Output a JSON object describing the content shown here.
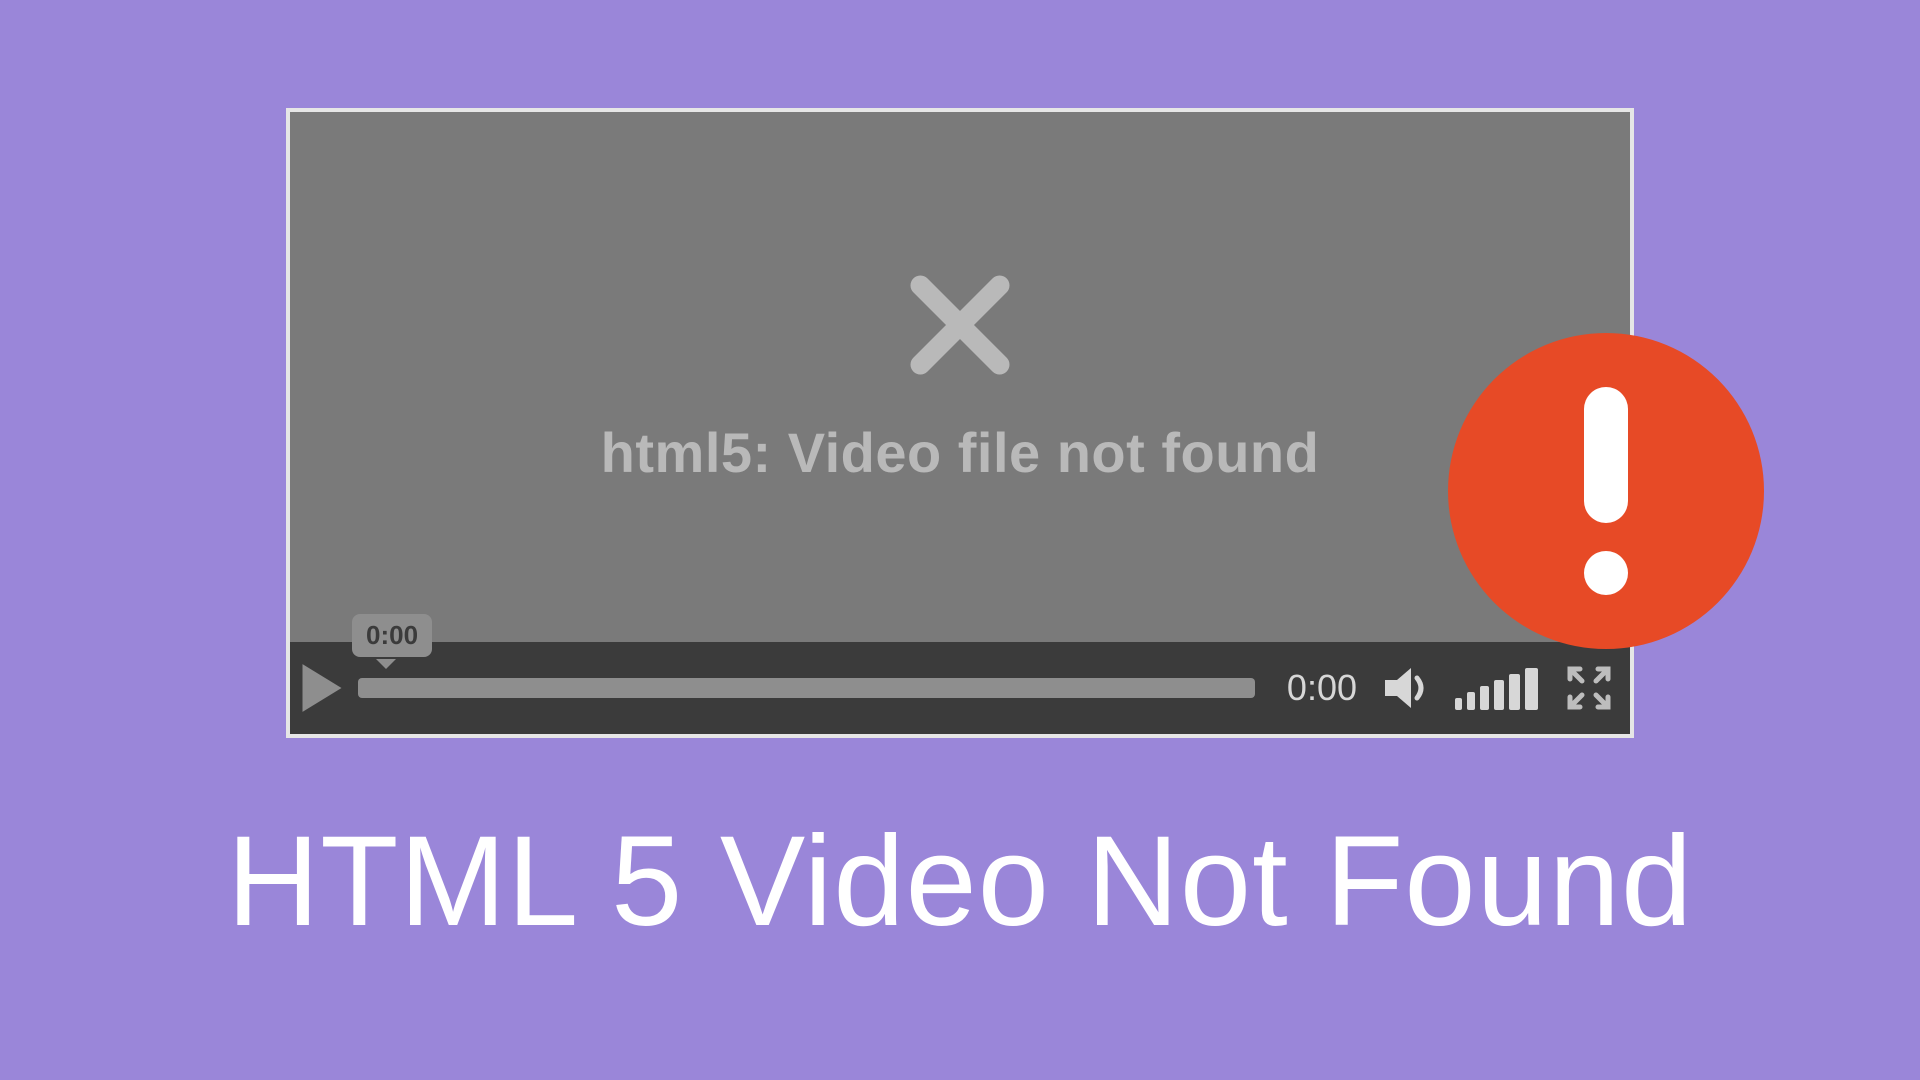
{
  "player": {
    "error_message": "html5: Video file not found",
    "tooltip_time": "0:00",
    "elapsed_time": "0:00"
  },
  "headline": "HTML 5 Video Not Found"
}
